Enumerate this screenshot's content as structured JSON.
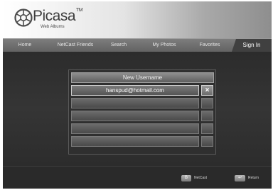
{
  "app": {
    "name": "Picasa",
    "tm": "TM",
    "subtitle": "Web Albums"
  },
  "nav": {
    "tabs": [
      {
        "label": "Home"
      },
      {
        "label": "NetCast Friends"
      },
      {
        "label": "Search"
      },
      {
        "label": "My Photos"
      },
      {
        "label": "Favorites"
      },
      {
        "label": "Sign In",
        "active": true
      }
    ]
  },
  "signin": {
    "new_username_label": "New Username",
    "accounts": [
      {
        "value": "hanspud@hotmail.com",
        "delete_label": "×"
      },
      {
        "value": ""
      },
      {
        "value": ""
      },
      {
        "value": ""
      },
      {
        "value": ""
      },
      {
        "value": ""
      }
    ]
  },
  "footer": {
    "netcast": {
      "key": "B",
      "label": "NetCast"
    },
    "return": {
      "key": "↩",
      "label": "Return"
    }
  },
  "colors": {
    "background": "#2b2b2b",
    "nav": "#6e6e6e",
    "active_tab": "#404040"
  },
  "icons": {
    "logo": "picasa-pinwheel-icon",
    "delete": "close-icon",
    "return": "return-arrow-icon"
  }
}
